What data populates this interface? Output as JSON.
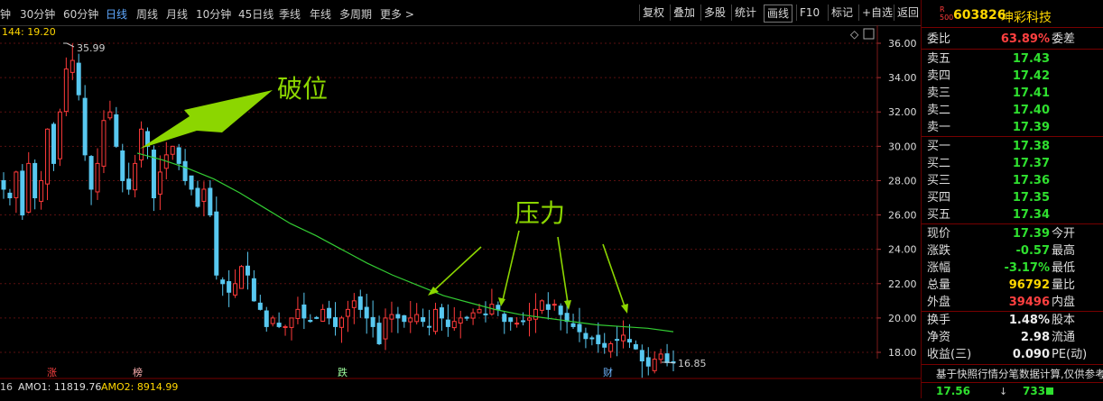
{
  "toolbar": {
    "periods": [
      "钟",
      "30分钟",
      "60分钟",
      "日线",
      "周线",
      "月线",
      "10分钟",
      "45日线",
      "季线",
      "年线",
      "多周期",
      "更多 >"
    ],
    "active_period": "日线",
    "buttons": [
      "复权",
      "叠加",
      "多股",
      "统计",
      "画线",
      "F10",
      "标记",
      "+自选",
      "返回"
    ],
    "selected_button": "画线"
  },
  "chart": {
    "ma_label": "144: 19.20",
    "high_label": "35.99",
    "low_label": "16.85",
    "y_ticks": [
      "36.00",
      "34.00",
      "32.00",
      "30.00",
      "28.00",
      "26.00",
      "24.00",
      "22.00",
      "20.00",
      "18.00"
    ],
    "annot_break": "破位",
    "annot_pressure": "压力",
    "markers": [
      "涨",
      "榜",
      "跌",
      "财"
    ],
    "vol_line_prefix": "16",
    "amo1": "AMO1: 11819.76",
    "amo2": "AMO2: 8914.99",
    "colors": {
      "up": "#ff3a3a",
      "down": "#58c8f0",
      "ma": "#33cc33",
      "arrow": "#8cd600",
      "grid": "#5a1010"
    }
  },
  "chart_data": {
    "type": "candlestick",
    "y_range": [
      16,
      37
    ],
    "highest": 35.99,
    "lowest": 16.85,
    "ma144_last": 19.2,
    "close_series": [
      27.5,
      27.0,
      28.5,
      26.0,
      29.0,
      27.0,
      28.0,
      31.0,
      29.0,
      32.0,
      34.5,
      35.0,
      33.0,
      29.5,
      27.5,
      29.0,
      31.5,
      32.0,
      30.0,
      28.0,
      27.5,
      29.0,
      31.0,
      30.0,
      27.0,
      28.5,
      29.5,
      30.0,
      29.0,
      28.0,
      27.5,
      26.5,
      27.5,
      26.0,
      22.5,
      22.0,
      21.5,
      22.0,
      23.0,
      22.5,
      21.0,
      20.5,
      19.5,
      20.0,
      19.5,
      19.5,
      20.0,
      20.5,
      20.0,
      19.8,
      20.0,
      20.5,
      20.0,
      19.5,
      20.0,
      20.5,
      21.0,
      20.5,
      20.0,
      19.5,
      18.5,
      20.0,
      20.2,
      20.0,
      19.8,
      20.0,
      20.2,
      19.8,
      19.5,
      20.5,
      20.0,
      19.5,
      19.8,
      20.0,
      20.0,
      20.3,
      20.5,
      20.2,
      20.8,
      20.5,
      19.8,
      19.8,
      19.7,
      19.8,
      20.0,
      20.5,
      21.0,
      20.5,
      20.8,
      20.2,
      19.8,
      19.5,
      19.2,
      18.8,
      18.8,
      18.5,
      18.3,
      18.5,
      18.7,
      19.0,
      18.6,
      18.2,
      17.5,
      17.2,
      17.6,
      17.9,
      17.4,
      17.39
    ],
    "ma144_series": [
      29.6,
      29.2,
      28.7,
      28.1,
      27.3,
      26.4,
      25.5,
      24.8,
      24.0,
      23.2,
      22.5,
      21.9,
      21.3,
      20.9,
      20.5,
      20.2,
      20.0,
      19.8,
      19.6,
      19.5,
      19.4,
      19.2
    ]
  },
  "quote": {
    "code": "603826",
    "name": "坤彩科技",
    "badge_top": "R",
    "badge_bottom": "500",
    "weibi_label": "委比",
    "weibi_value": "63.89%",
    "weicha_label": "委差",
    "asks": [
      {
        "label": "卖五",
        "price": "17.43"
      },
      {
        "label": "卖四",
        "price": "17.42"
      },
      {
        "label": "卖三",
        "price": "17.41"
      },
      {
        "label": "卖二",
        "price": "17.40"
      },
      {
        "label": "卖一",
        "price": "17.39"
      }
    ],
    "bids": [
      {
        "label": "买一",
        "price": "17.38"
      },
      {
        "label": "买二",
        "price": "17.37"
      },
      {
        "label": "买三",
        "price": "17.36"
      },
      {
        "label": "买四",
        "price": "17.35"
      },
      {
        "label": "买五",
        "price": "17.34"
      }
    ],
    "stats1": [
      {
        "label": "现价",
        "value": "17.39",
        "label2": "今开",
        "color": "green"
      },
      {
        "label": "涨跌",
        "value": "-0.57",
        "label2": "最高",
        "color": "green"
      },
      {
        "label": "涨幅",
        "value": "-3.17%",
        "label2": "最低",
        "color": "green"
      },
      {
        "label": "总量",
        "value": "96792",
        "label2": "量比",
        "color": "yellow"
      },
      {
        "label": "外盘",
        "value": "39496",
        "label2": "内盘",
        "color": "red"
      }
    ],
    "stats2": [
      {
        "label": "换手",
        "value": "1.48%",
        "label2": "股本",
        "color": "white"
      },
      {
        "label": "净资",
        "value": "2.98",
        "label2": "流通",
        "color": "white"
      },
      {
        "label": "收益(三)",
        "value": "0.090",
        "label2": "PE(动)",
        "color": "white"
      }
    ],
    "note": "基于快照行情分笔数据计算,仅供参考",
    "foot_price": "17.56",
    "foot_vol": "733"
  }
}
